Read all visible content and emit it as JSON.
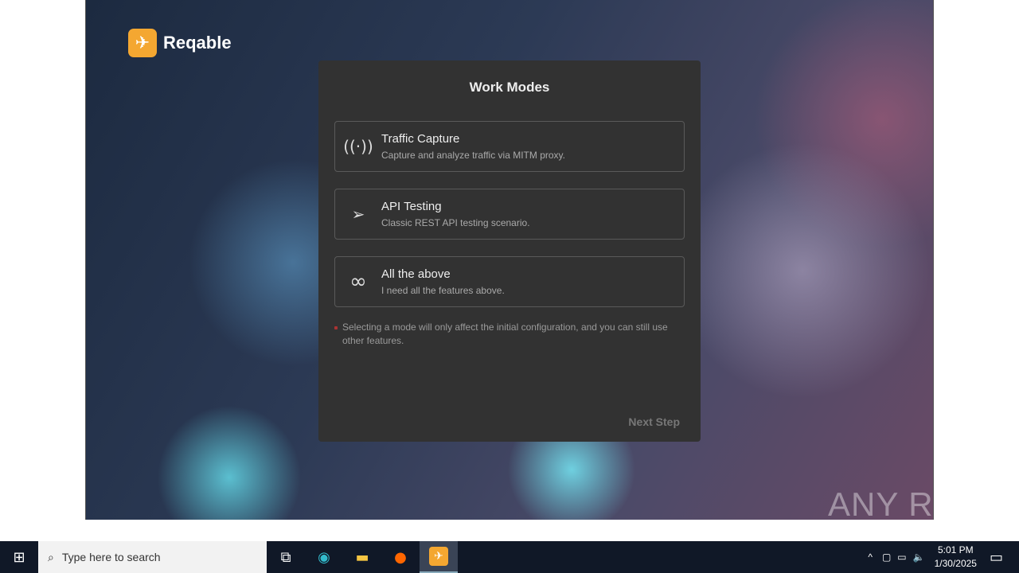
{
  "app": {
    "name": "Reqable",
    "title": "Work Modes",
    "modes": [
      {
        "icon": "broadcast-icon",
        "title": "Traffic Capture",
        "desc": "Capture and analyze traffic via MITM proxy."
      },
      {
        "icon": "paper-plane-icon",
        "title": "API Testing",
        "desc": "Classic REST API testing scenario."
      },
      {
        "icon": "infinity-icon",
        "title": "All the above",
        "desc": "I need all the features above."
      }
    ],
    "note": "Selecting a mode will only affect the initial configuration, and you can still use other features.",
    "next_label": "Next Step"
  },
  "watermark": "ANY RUN",
  "taskbar": {
    "search_placeholder": "Type here to search",
    "time": "5:01 PM",
    "date": "1/30/2025"
  }
}
